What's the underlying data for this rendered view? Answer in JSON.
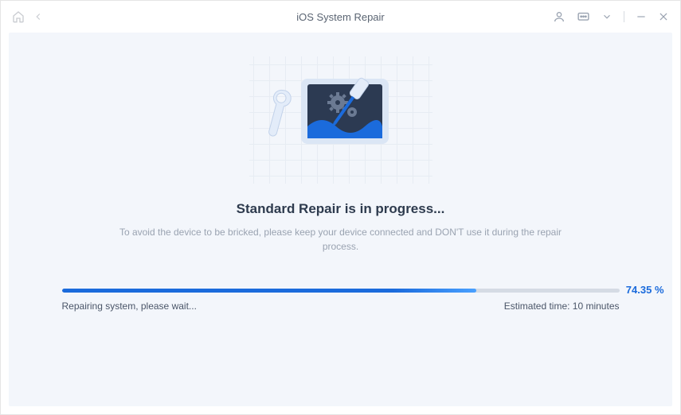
{
  "titlebar": {
    "title": "iOS System Repair"
  },
  "main": {
    "heading": "Standard Repair is in progress...",
    "subtext": "To avoid the device to be bricked, please keep your device connected and DON'T use it during the repair process."
  },
  "progress": {
    "percent_value": 74.35,
    "percent_label": "74.35 %",
    "fill_width": "74.35%",
    "status_text": "Repairing system, please wait...",
    "estimated_time": "Estimated time: 10 minutes"
  },
  "colors": {
    "accent": "#1b6bdc"
  }
}
